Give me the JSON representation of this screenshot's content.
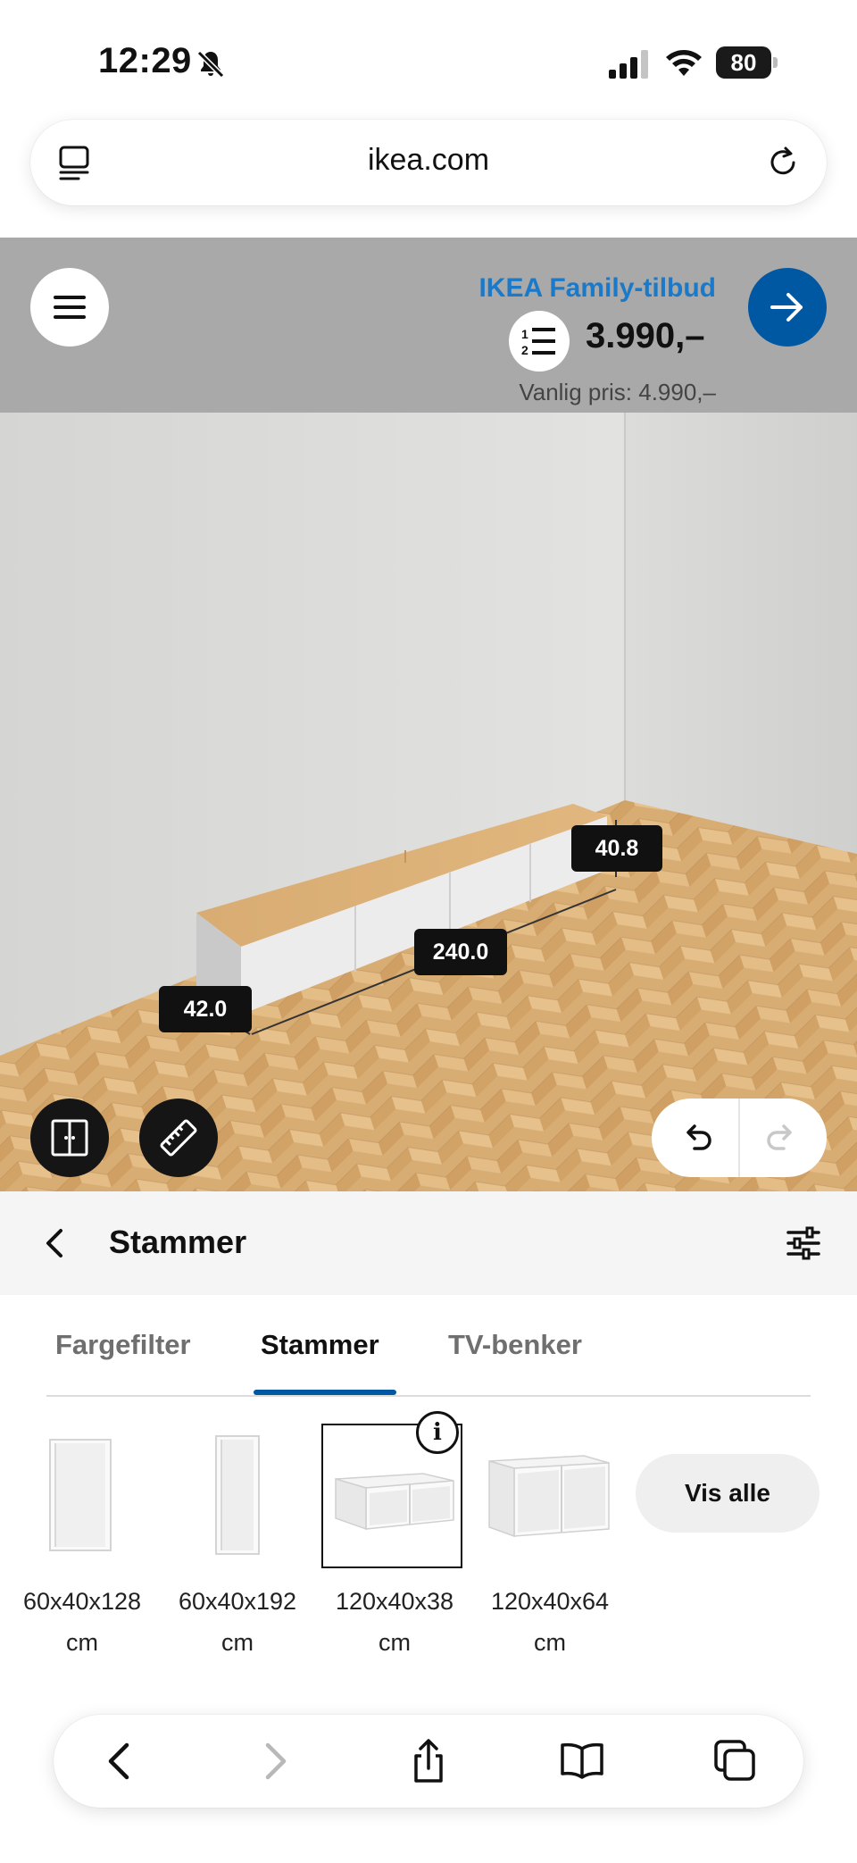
{
  "status_bar": {
    "time": "12:29",
    "battery": "80"
  },
  "browser": {
    "url": "ikea.com"
  },
  "viewer": {
    "family_offer": "IKEA Family-tilbud",
    "price": "3.990,–",
    "regular_price": "Vanlig pris: 4.990,–",
    "dimensions": {
      "height": "40.8",
      "width": "240.0",
      "depth": "42.0"
    }
  },
  "panel": {
    "title": "Stammer"
  },
  "tabs": [
    {
      "label": "Fargefilter",
      "active": false
    },
    {
      "label": "Stammer",
      "active": true
    },
    {
      "label": "TV-benker",
      "active": false
    }
  ],
  "products": [
    {
      "size": "60x40x128",
      "unit": "cm",
      "selected": false
    },
    {
      "size": "60x40x192",
      "unit": "cm",
      "selected": false
    },
    {
      "size": "120x40x38",
      "unit": "cm",
      "selected": true
    },
    {
      "size": "120x40x64",
      "unit": "cm",
      "selected": false
    }
  ],
  "show_all_label": "Vis alle",
  "colors": {
    "accent": "#0058a3",
    "family_link": "#1a7ac9"
  }
}
